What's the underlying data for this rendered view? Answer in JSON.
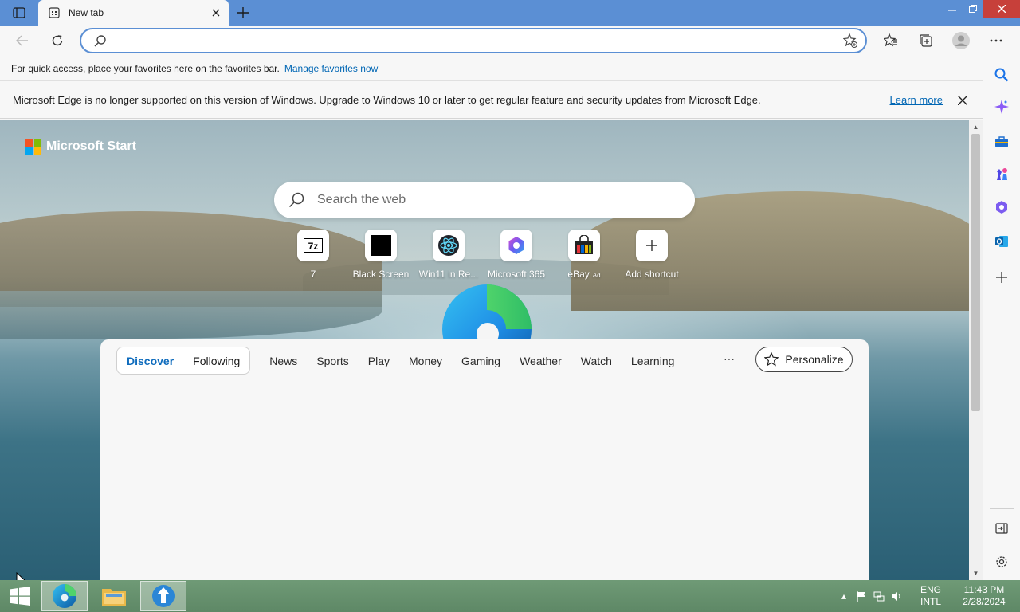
{
  "tab": {
    "title": "New tab"
  },
  "address": {
    "value": "",
    "placeholder": ""
  },
  "favorites_bar": {
    "text": "For quick access, place your favorites here on the favorites bar.",
    "link": "Manage favorites now"
  },
  "infobar": {
    "message": "Microsoft Edge is no longer supported on this version of Windows. Upgrade to Windows 10 or later to get regular feature and security updates from Microsoft Edge.",
    "learn_more": "Learn more"
  },
  "brand": {
    "name": "Microsoft Start"
  },
  "search": {
    "placeholder": "Search the web"
  },
  "shortcuts": [
    {
      "label": "7",
      "icon": "7zip-icon"
    },
    {
      "label": "Black Screen",
      "icon": "black-square-icon"
    },
    {
      "label": "Win11 in Re...",
      "icon": "react-icon"
    },
    {
      "label": "Microsoft 365",
      "icon": "m365-icon"
    },
    {
      "label": "eBay",
      "ad": "Ad",
      "icon": "ebay-bag-icon"
    },
    {
      "label": "Add shortcut",
      "icon": "plus-icon"
    }
  ],
  "feed": {
    "pill": [
      "Discover",
      "Following"
    ],
    "categories": [
      "News",
      "Sports",
      "Play",
      "Money",
      "Gaming",
      "Weather",
      "Watch",
      "Learning"
    ],
    "more": "···",
    "personalize": "Personalize"
  },
  "tray": {
    "lang1": "ENG",
    "lang2": "INTL",
    "time": "11:43 PM",
    "date": "2/28/2024"
  },
  "colors": {
    "titlebar": "#5b8fd4",
    "accent": "#0f6cbd",
    "close": "#c7403a",
    "taskbar": "#6a9470"
  }
}
